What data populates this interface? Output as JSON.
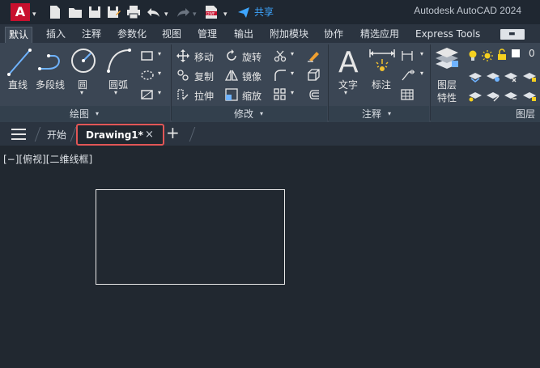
{
  "titlebar": {
    "logo": "A",
    "app_title": "Autodesk AutoCAD 2024",
    "share_label": "共享",
    "dwf_label": "DWF"
  },
  "ribbon_tabs": [
    "默认",
    "插入",
    "注释",
    "参数化",
    "视图",
    "管理",
    "输出",
    "附加模块",
    "协作",
    "精选应用",
    "Express Tools"
  ],
  "active_tab": "默认",
  "panels": {
    "draw": {
      "title": "绘图",
      "tools": [
        "直线",
        "多段线",
        "圆",
        "圆弧"
      ]
    },
    "modify": {
      "title": "修改",
      "tools": [
        "移动",
        "旋转",
        "复制",
        "镜像",
        "拉伸",
        "缩放"
      ]
    },
    "annotation": {
      "title": "注释",
      "tools": [
        "文字",
        "标注"
      ]
    },
    "layers": {
      "title": "图层",
      "tool_label_1": "图层",
      "tool_label_2": "特性",
      "layer_value": "0"
    }
  },
  "file_tabs": {
    "start": "开始",
    "drawing": "Drawing1*",
    "close": "×",
    "add": "+"
  },
  "viewport": {
    "label": "[−][俯视][二维线框]"
  },
  "colors": {
    "accent_red": "#c8102e",
    "share_blue": "#3ea6ff",
    "highlight_border": "#e25656",
    "canvas_bg": "#212830"
  }
}
